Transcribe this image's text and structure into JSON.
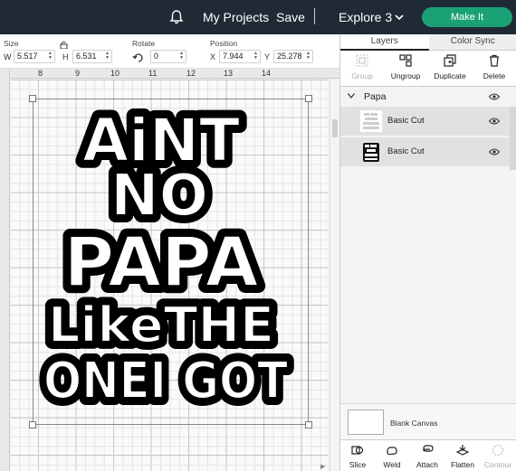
{
  "topbar": {
    "projects_label": "My Projects",
    "save_label": "Save",
    "separator": "|",
    "machine_label": "Explore 3",
    "make_it_label": "Make It",
    "make_it_color": "#1aa276",
    "icons": [
      "bell-icon",
      "chevron-down-icon"
    ]
  },
  "edit_toolbar": {
    "size_label": "Size",
    "w_label": "W",
    "w_value": "5.517",
    "h_label": "H",
    "h_value": "6.531",
    "rotate_label": "Rotate",
    "rotate_value": "0",
    "position_label": "Position",
    "x_label": "X",
    "x_value": "7.944",
    "y_label": "Y",
    "y_value": "25.278"
  },
  "ruler": {
    "ticks": [
      "8",
      "9",
      "10",
      "11",
      "12",
      "13",
      "14"
    ]
  },
  "design": {
    "lines": [
      "AiNT",
      "NO",
      "PAPA",
      "LikeTHE",
      "ONEI GOT"
    ]
  },
  "panel": {
    "tabs": [
      "Layers",
      "Color Sync"
    ],
    "actions": [
      "Group",
      "Ungroup",
      "Duplicate",
      "Delete"
    ],
    "group_name": "Papa",
    "layers": [
      {
        "name": "Basic Cut"
      },
      {
        "name": "Basic Cut"
      }
    ],
    "blank_canvas_label": "Blank Canvas",
    "bottom_actions": [
      "Slice",
      "Weld",
      "Attach",
      "Flatten",
      "Contour"
    ]
  }
}
